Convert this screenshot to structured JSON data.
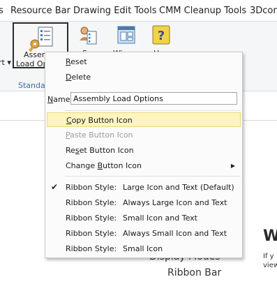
{
  "tabs": [
    {
      "label": "s"
    },
    {
      "label": "Resource Bar"
    },
    {
      "label": "Drawing Edit Tools"
    },
    {
      "label": "CMM Cleanup Tools"
    },
    {
      "label": "3Dcon"
    }
  ],
  "ribbon": {
    "left_cut_label": "rt ▾",
    "buttons": [
      {
        "caption_line1": "Assem",
        "caption_line2": "Load Op",
        "icon": "assembly-load-options-icon"
      },
      {
        "caption_line1": "Sc",
        "icon": "user-options-icon"
      },
      {
        "caption_line1": "Wi",
        "icon": "window-options-icon"
      },
      {
        "caption_line1": "H",
        "icon": "help-icon"
      }
    ],
    "group_label": "Standar"
  },
  "document": {
    "heading": "W",
    "line1": "If y",
    "line2": "view",
    "display_modes": "Display Modes",
    "ribbon_bar": "Ribbon Bar"
  },
  "menu": {
    "reset": {
      "u": "R",
      "rest": "eset"
    },
    "delete": {
      "u": "D",
      "rest": "elete"
    },
    "name_label_u": "N",
    "name_label_rest": "ame",
    "name_value": "Assembly Load Options",
    "copy_icon": {
      "pre": "",
      "u": "C",
      "rest": "opy Button Icon"
    },
    "paste_icon": {
      "pre": "",
      "u": "P",
      "rest": "aste Button Icon"
    },
    "reset_icon": {
      "pre": "Re",
      "u": "s",
      "rest": "et Button Icon"
    },
    "change_icon": {
      "pre": "Change ",
      "u": "B",
      "rest": "utton Icon"
    },
    "submenu_arrow": "▶",
    "check_mark": "✔",
    "ribbon_styles": [
      {
        "label": "Ribbon Style:",
        "value": "Large Icon and Text (Default)",
        "checked": true
      },
      {
        "label": "Ribbon Style:",
        "value": "Always Large Icon and Text",
        "checked": false
      },
      {
        "label": "Ribbon Style:",
        "value": "Small Icon and Text",
        "checked": false
      },
      {
        "label": "Ribbon Style:",
        "value": "Always Small Icon and Text",
        "checked": false
      },
      {
        "label": "Ribbon Style:",
        "value": "Small Icon",
        "checked": false
      }
    ]
  },
  "colors": {
    "highlight_bg": "#fdf4bf",
    "highlight_border": "#f0d97a",
    "group_label": "#3b6ea5"
  }
}
